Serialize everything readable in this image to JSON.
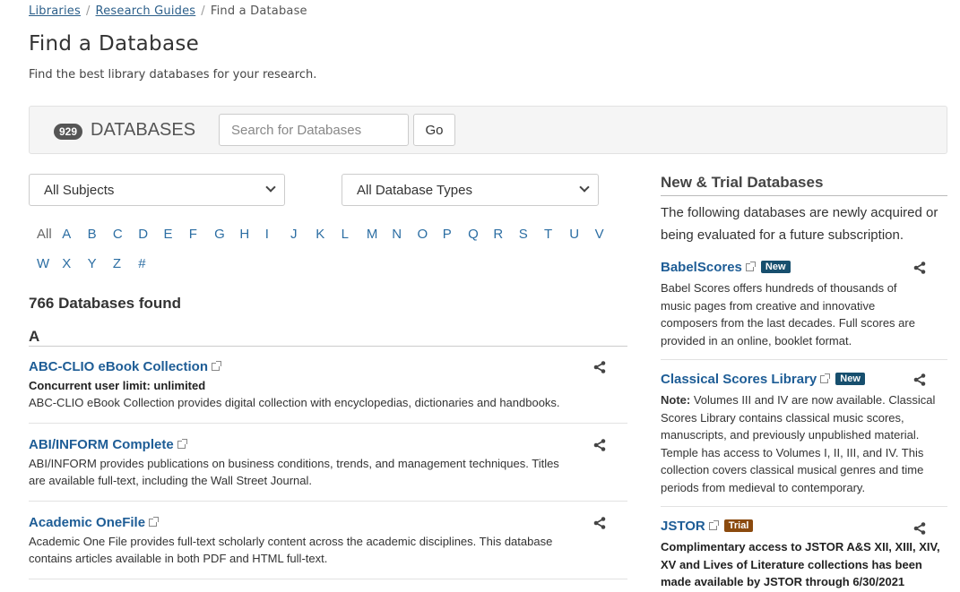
{
  "breadcrumb": {
    "items": [
      "Libraries",
      "Research Guides"
    ],
    "current": "Find a Database",
    "separator": "/"
  },
  "page": {
    "title": "Find a Database",
    "subtitle": "Find the best library databases for your research."
  },
  "search": {
    "count": "929",
    "label": "DATABASES",
    "placeholder": "Search for Databases",
    "button": "Go"
  },
  "filters": {
    "subjects": "All Subjects",
    "types": "All Database Types"
  },
  "az": {
    "row1": [
      "All",
      "A",
      "B",
      "C",
      "D",
      "E",
      "F",
      "G",
      "H",
      "I",
      "J",
      "K",
      "L",
      "M",
      "N",
      "O",
      "P",
      "Q",
      "R",
      "S",
      "T",
      "U",
      "V"
    ],
    "row2": [
      "W",
      "X",
      "Y",
      "Z",
      "#"
    ]
  },
  "results": {
    "found": "766 Databases found",
    "letter": "A",
    "items": [
      {
        "title": "ABC-CLIO eBook Collection",
        "note": "Concurrent user limit: unlimited",
        "desc": "ABC-CLIO eBook Collection provides digital collection with encyclopedias, dictionaries and handbooks."
      },
      {
        "title": "ABI/INFORM Complete",
        "desc": "ABI/INFORM provides publications on business conditions, trends, and management techniques. Titles are available full-text, including the Wall Street Journal."
      },
      {
        "title": "Academic OneFile",
        "desc": "Academic One File provides full-text scholarly content across the academic disciplines. This database contains articles available in both PDF and HTML full-text."
      }
    ]
  },
  "sidebar": {
    "heading": "New & Trial Databases",
    "intro": "The following databases are newly acquired or being evaluated for a future subscription.",
    "items": [
      {
        "title": "BabelScores",
        "badge": "New",
        "desc": "Babel Scores offers hundreds of thousands of music pages from creative and innovative composers from the last decades. Full scores are provided in an online, booklet format."
      },
      {
        "title": "Classical Scores Library",
        "badge": "New",
        "note_label": "Note:",
        "desc": "Volumes III and IV are now available. Classical Scores Library contains classical music scores, manuscripts, and previously unpublished material. Temple has access to Volumes I, II, III, and IV. This collection covers classical musical genres and time periods from medieval to contemporary."
      },
      {
        "title": "JSTOR",
        "badge": "Trial",
        "desc": "Complimentary access to JSTOR A&S XII, XIII, XIV, XV and Lives of Literature collections has been made available by JSTOR through 6/30/2021"
      }
    ]
  },
  "icons": {
    "share": "share-icon",
    "external": "external-link-icon",
    "chevron": "chevron-down-icon"
  },
  "colors": {
    "link": "#1e5d96",
    "az_link": "#2c6ea3",
    "badge_new": "#174f6e",
    "badge_trial": "#8b4a0e"
  }
}
